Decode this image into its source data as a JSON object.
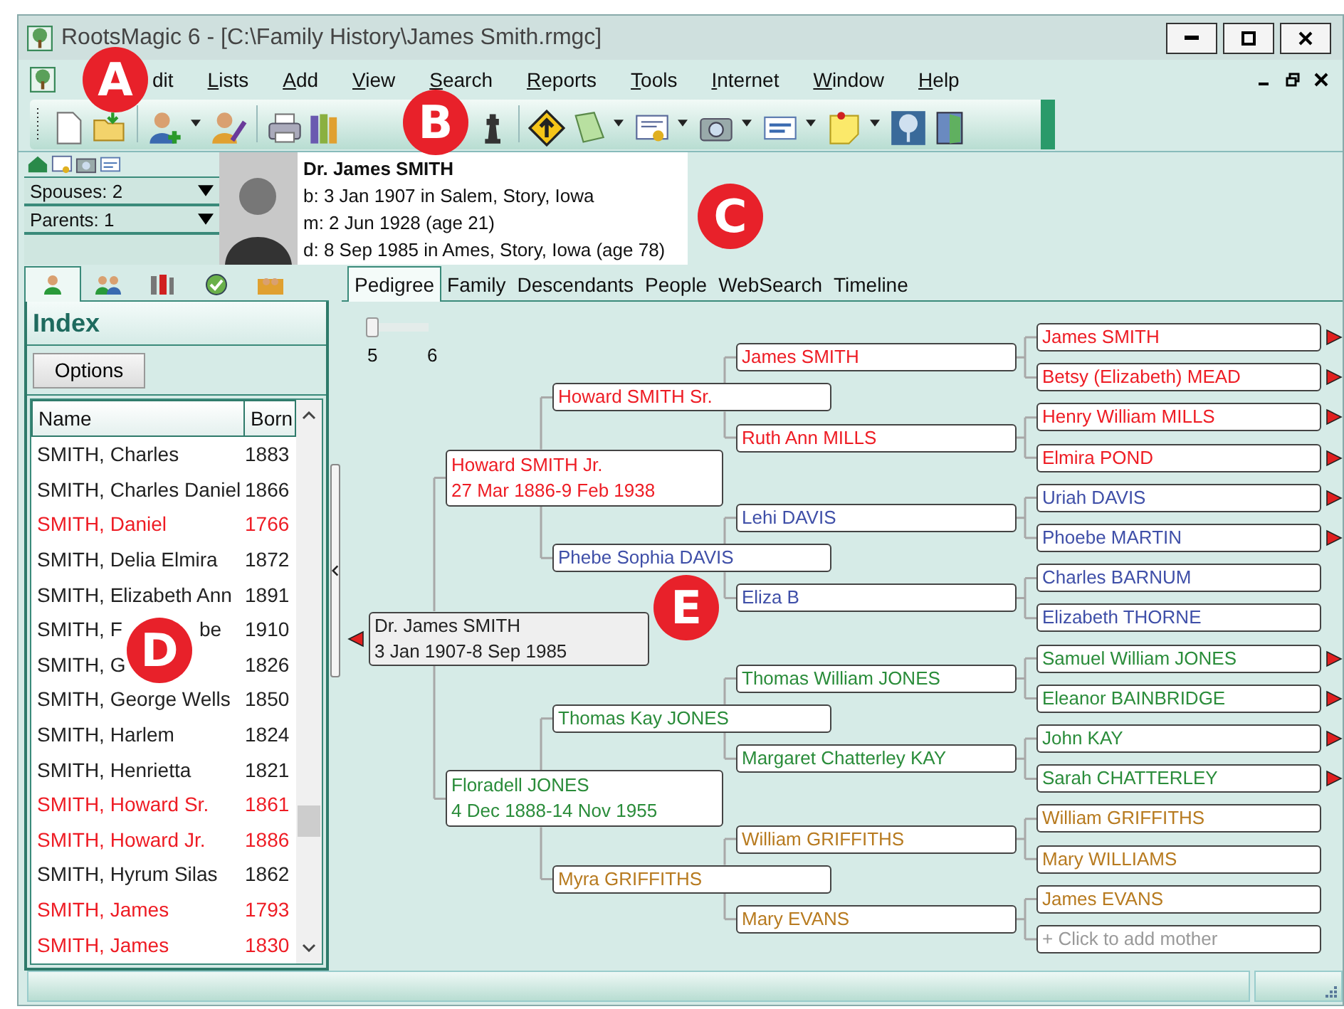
{
  "window": {
    "title": "RootsMagic 6 - [C:\\Family History\\James Smith.rmgc]"
  },
  "menu": [
    {
      "label": "dit",
      "accel": false
    },
    {
      "label": "Lists",
      "accel": true
    },
    {
      "label": "Add",
      "accel": true
    },
    {
      "label": "View",
      "accel": true
    },
    {
      "label": "Search",
      "accel": true
    },
    {
      "label": "Reports",
      "accel": true
    },
    {
      "label": "Tools",
      "accel": true
    },
    {
      "label": "Internet",
      "accel": true
    },
    {
      "label": "Window",
      "accel": true
    },
    {
      "label": "Help",
      "accel": true
    }
  ],
  "person_panel": {
    "dropdowns": [
      "Spouses: 2",
      "Parents: 1"
    ],
    "name": "Dr. James SMITH",
    "facts": [
      "b: 3 Jan 1907 in Salem, Story, Iowa",
      "m: 2 Jun 1928 (age 21)",
      "d: 8 Sep 1985 in Ames, Story, Iowa (age 78)"
    ]
  },
  "side_tabs": [
    {
      "selected": true
    },
    {
      "selected": false
    },
    {
      "selected": false
    },
    {
      "selected": false
    },
    {
      "selected": false
    }
  ],
  "index": {
    "title": "Index",
    "options_button": "Options",
    "columns": [
      "Name",
      "Born"
    ],
    "rows": [
      {
        "name": "SMITH, Charles",
        "born": "1883",
        "color": "#222222"
      },
      {
        "name": "SMITH, Charles Daniel",
        "born": "1866",
        "color": "#222222"
      },
      {
        "name": "SMITH, Daniel",
        "born": "1766",
        "color": "#ee1c24"
      },
      {
        "name": "SMITH, Delia Elmira",
        "born": "1872",
        "color": "#222222"
      },
      {
        "name": "SMITH, Elizabeth Ann",
        "born": "1891",
        "color": "#222222"
      },
      {
        "name": "SMITH, F",
        "tail": "be",
        "born": "1910",
        "color": "#222222"
      },
      {
        "name": "SMITH, G",
        "born": "1826",
        "color": "#222222"
      },
      {
        "name": "SMITH, George Wells",
        "born": "1850",
        "color": "#222222"
      },
      {
        "name": "SMITH, Harlem",
        "born": "1824",
        "color": "#222222"
      },
      {
        "name": "SMITH, Henrietta",
        "born": "1821",
        "color": "#222222"
      },
      {
        "name": "SMITH, Howard Sr.",
        "born": "1861",
        "color": "#ee1c24"
      },
      {
        "name": "SMITH, Howard Jr.",
        "born": "1886",
        "color": "#ee1c24"
      },
      {
        "name": "SMITH, Hyrum Silas",
        "born": "1862",
        "color": "#222222"
      },
      {
        "name": "SMITH, James",
        "born": "1793",
        "color": "#ee1c24"
      },
      {
        "name": "SMITH, James",
        "born": "1830",
        "color": "#ee1c24"
      }
    ]
  },
  "view_tabs": [
    {
      "label": "Pedigree",
      "selected": true
    },
    {
      "label": "Family",
      "selected": false
    },
    {
      "label": "Descendants",
      "selected": false
    },
    {
      "label": "People",
      "selected": false
    },
    {
      "label": "WebSearch",
      "selected": false
    },
    {
      "label": "Timeline",
      "selected": false
    }
  ],
  "generations_slider": {
    "level": 0,
    "labels": [
      "5",
      "6"
    ]
  },
  "pedigree": {
    "kind": "person",
    "name": "Dr. James SMITH",
    "dates": "3 Jan 1907-8 Sep 1985",
    "color": "#222222",
    "has_descendants": true,
    "parents": [
      {
        "kind": "person",
        "name": "Howard SMITH Jr.",
        "dates": "27 Mar 1886-9 Feb 1938",
        "color": "#ee1c24",
        "parents": [
          {
            "kind": "person",
            "name": "Howard SMITH Sr.",
            "color": "#ee1c24",
            "parents": [
              {
                "kind": "person",
                "name": "James SMITH",
                "color": "#ee1c24",
                "parents": [
                  {
                    "kind": "person",
                    "name": "James SMITH",
                    "color": "#ee1c24",
                    "has_ancestors": true
                  },
                  {
                    "kind": "person",
                    "name": "Betsy (Elizabeth) MEAD",
                    "color": "#ee1c24",
                    "has_ancestors": true
                  }
                ]
              },
              {
                "kind": "person",
                "name": "Ruth Ann MILLS",
                "color": "#ee1c24",
                "parents": [
                  {
                    "kind": "person",
                    "name": "Henry William MILLS",
                    "color": "#ee1c24",
                    "has_ancestors": true
                  },
                  {
                    "kind": "person",
                    "name": "Elmira POND",
                    "color": "#ee1c24",
                    "has_ancestors": true
                  }
                ]
              }
            ]
          },
          {
            "kind": "person",
            "name": "Phebe Sophia DAVIS",
            "color": "#3f4fa8",
            "parents": [
              {
                "kind": "person",
                "name": "Lehi DAVIS",
                "color": "#3f4fa8",
                "parents": [
                  {
                    "kind": "person",
                    "name": "Uriah DAVIS",
                    "color": "#3f4fa8",
                    "has_ancestors": true
                  },
                  {
                    "kind": "person",
                    "name": "Phoebe MARTIN",
                    "color": "#3f4fa8",
                    "has_ancestors": true
                  }
                ]
              },
              {
                "kind": "person",
                "name": "Eliza B",
                "color": "#3f4fa8",
                "parents": [
                  {
                    "kind": "person",
                    "name": "Charles BARNUM",
                    "color": "#3f4fa8",
                    "has_ancestors": false
                  },
                  {
                    "kind": "person",
                    "name": "Elizabeth THORNE",
                    "color": "#3f4fa8",
                    "has_ancestors": false
                  }
                ]
              }
            ]
          }
        ]
      },
      {
        "kind": "person",
        "name": "Floradell JONES",
        "dates": "4 Dec 1888-14 Nov 1955",
        "color": "#2a8c3a",
        "parents": [
          {
            "kind": "person",
            "name": "Thomas Kay JONES",
            "color": "#2a8c3a",
            "parents": [
              {
                "kind": "person",
                "name": "Thomas William JONES",
                "color": "#2a8c3a",
                "parents": [
                  {
                    "kind": "person",
                    "name": "Samuel William JONES",
                    "color": "#2a8c3a",
                    "has_ancestors": true
                  },
                  {
                    "kind": "person",
                    "name": "Eleanor BAINBRIDGE",
                    "color": "#2a8c3a",
                    "has_ancestors": true
                  }
                ]
              },
              {
                "kind": "person",
                "name": "Margaret Chatterley KAY",
                "color": "#2a8c3a",
                "parents": [
                  {
                    "kind": "person",
                    "name": "John KAY",
                    "color": "#2a8c3a",
                    "has_ancestors": true
                  },
                  {
                    "kind": "person",
                    "name": "Sarah CHATTERLEY",
                    "color": "#2a8c3a",
                    "has_ancestors": true
                  }
                ]
              }
            ]
          },
          {
            "kind": "person",
            "name": "Myra GRIFFITHS",
            "color": "#b77a1f",
            "parents": [
              {
                "kind": "person",
                "name": "William GRIFFITHS",
                "color": "#b77a1f",
                "parents": [
                  {
                    "kind": "person",
                    "name": "William GRIFFITHS",
                    "color": "#b77a1f",
                    "has_ancestors": false
                  },
                  {
                    "kind": "person",
                    "name": "Mary WILLIAMS",
                    "color": "#b77a1f",
                    "has_ancestors": false
                  }
                ]
              },
              {
                "kind": "person",
                "name": "Mary EVANS",
                "color": "#b77a1f",
                "parents": [
                  {
                    "kind": "person",
                    "name": "James EVANS",
                    "color": "#b77a1f",
                    "has_ancestors": false
                  },
                  {
                    "kind": "placeholder",
                    "name": "+ Click to add mother"
                  }
                ]
              }
            ]
          }
        ]
      }
    ]
  },
  "callouts": [
    "A",
    "B",
    "C",
    "D",
    "E"
  ]
}
